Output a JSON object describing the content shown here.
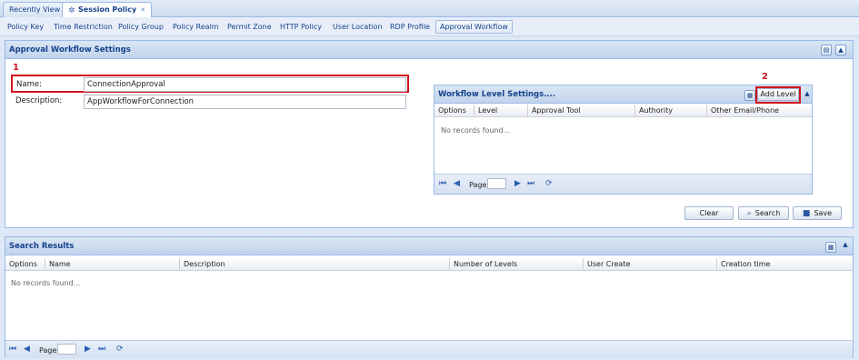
{
  "tabs": [
    {
      "label": "Recently View"
    },
    {
      "label": "Session Policy"
    }
  ],
  "subnav": [
    "Policy Key",
    "Time Restriction",
    "Policy Group",
    "Policy Realm",
    "Permit Zone",
    "HTTP Policy",
    "User Location",
    "RDP Profile",
    "Approval Workflow"
  ],
  "settings": {
    "title": "Approval Workflow Settings",
    "name_label": "Name:",
    "name_value": "ConnectionApproval",
    "desc_label": "Description:",
    "desc_value": "AppWorkflowForConnection",
    "annotation_1": "1",
    "annotation_2": "2"
  },
  "workflow": {
    "title": "Workflow Level Settings....",
    "add_level": "Add Level",
    "columns": [
      "Options",
      "Level",
      "Approval Tool",
      "Authority",
      "Other Email/Phone"
    ],
    "empty": "No records found...",
    "page_label": "Page"
  },
  "actions": {
    "clear": "Clear",
    "search": "Search",
    "save": "Save"
  },
  "results": {
    "title": "Search Results",
    "columns": [
      "Options",
      "Name",
      "Description",
      "Number of Levels",
      "User Create",
      "Creation time"
    ],
    "empty": "No records found...",
    "page_label": "Page"
  }
}
